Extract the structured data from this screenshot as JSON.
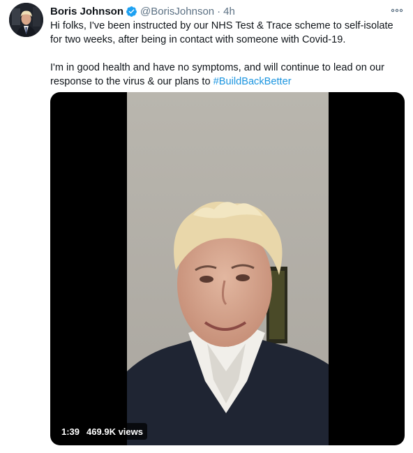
{
  "tweet": {
    "author": {
      "name": "Boris Johnson",
      "handle": "@BorisJohnson",
      "verified": true,
      "verified_icon": "verified-badge-icon",
      "avatar_icon": "profile-photo"
    },
    "separator": "·",
    "timestamp": "4h",
    "more_icon": "more-options-icon",
    "text": {
      "paragraph1": "Hi folks, I've been instructed by our NHS Test & Trace scheme to self-isolate for two weeks, after being in contact with someone with Covid-19.",
      "paragraph2_prefix": "I'm in good health and have no symptoms, and will continue to lead on our response to the virus & our plans to ",
      "hashtag": "#BuildBackBetter"
    },
    "media": {
      "type": "video",
      "duration": "1:39",
      "views": "469.9K views"
    }
  },
  "colors": {
    "link": "#1b95e0",
    "secondary_text": "#5b7083",
    "verified": "#1da1f2"
  }
}
